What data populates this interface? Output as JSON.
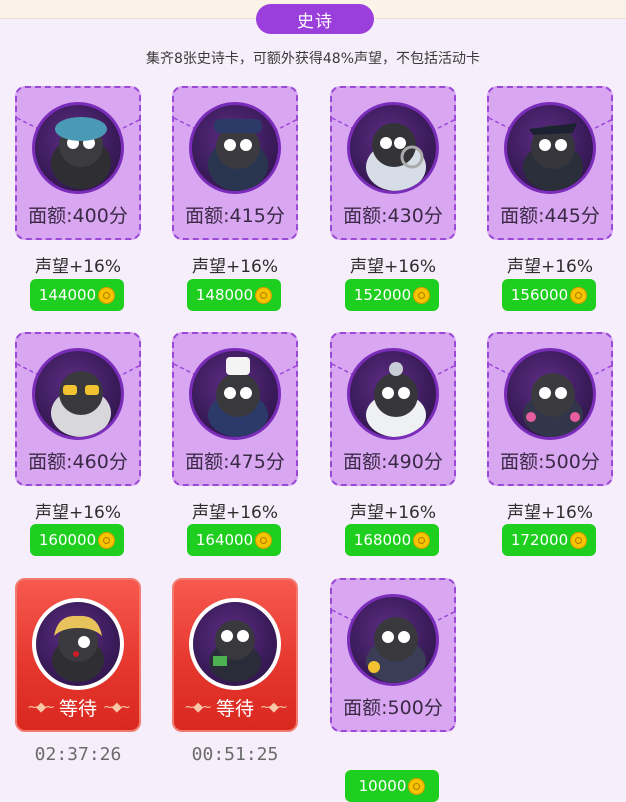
{
  "section": {
    "title": "史诗"
  },
  "subtitle": "集齐8张史诗卡，可额外获得48%声望，不包括活动卡",
  "cards": [
    {
      "face": "面额:400分",
      "reputation": "声望+16%",
      "price": "144000"
    },
    {
      "face": "面额:415分",
      "reputation": "声望+16%",
      "price": "148000"
    },
    {
      "face": "面额:430分",
      "reputation": "声望+16%",
      "price": "152000"
    },
    {
      "face": "面额:445分",
      "reputation": "声望+16%",
      "price": "156000"
    },
    {
      "face": "面额:460分",
      "reputation": "声望+16%",
      "price": "160000"
    },
    {
      "face": "面额:475分",
      "reputation": "声望+16%",
      "price": "164000"
    },
    {
      "face": "面额:490分",
      "reputation": "声望+16%",
      "price": "168000"
    },
    {
      "face": "面额:500分",
      "reputation": "声望+16%",
      "price": "172000"
    }
  ],
  "waiting_cards": [
    {
      "status": "等待",
      "timer": "02:37:26"
    },
    {
      "status": "等待",
      "timer": "00:51:25"
    }
  ],
  "event_card": {
    "face": "面额:500分",
    "price": "10000"
  },
  "colors": {
    "section_pill": "#9b3fdc",
    "card_purple": "#d9a6f2",
    "card_border": "#9a48d6",
    "card_red": "#e6382f",
    "price_green": "#1fcf1f",
    "coin_gold": "#f6c400"
  },
  "icons": {
    "coin": "gold-coin-icon",
    "portrait": "character-avatar"
  }
}
